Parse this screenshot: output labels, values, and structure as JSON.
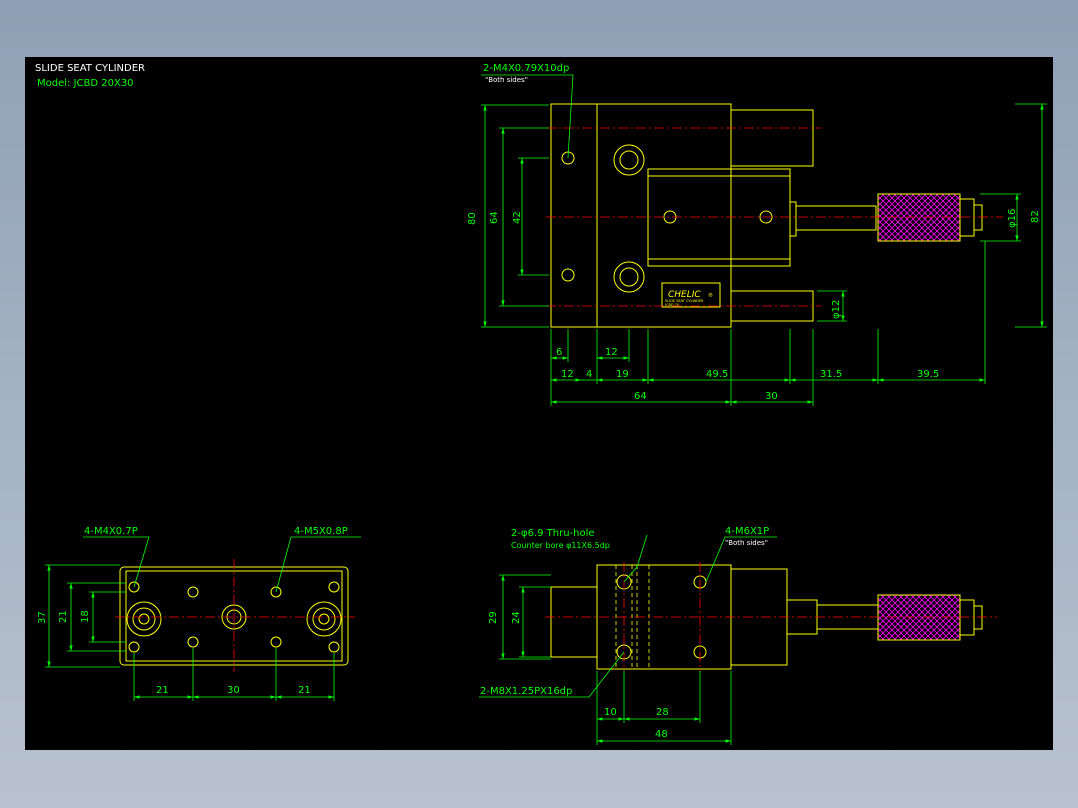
{
  "header": {
    "title": "SLIDE SEAT CYLINDER",
    "model": "Model:  JCBD 20X30"
  },
  "top_view": {
    "thread_note": "2-M4X0.79X10dp",
    "thread_note_sub": "\"Both sides\"",
    "brand": "CHELIC",
    "brand_suffix": "®",
    "label_line1": "SLIDE SEAT CYLINDER",
    "label_line2": "JCBD 20",
    "dims": {
      "h80": "80",
      "h64": "64",
      "h42": "42",
      "d16": "φ16",
      "h82": "82",
      "d12": "φ12",
      "w6": "6",
      "w12a": "12",
      "w12b": "12",
      "w4": "4",
      "w19": "19",
      "w49_5": "49.5",
      "w31_5": "31.5",
      "w39_5": "39.5",
      "w64": "64",
      "w30": "30"
    }
  },
  "end_view": {
    "note_left": "4-M4X0.7P",
    "note_right": "4-M5X0.8P",
    "dims": {
      "h37": "37",
      "h21": "21",
      "h18": "18",
      "w21a": "21",
      "w30": "30",
      "w21b": "21"
    }
  },
  "side_view": {
    "note_hole": "2-φ6.9  Thru-hole",
    "note_bore": "Counter bore  φ11X6.5dp",
    "note_m6": "4-M6X1P",
    "note_m6_sub": "\"Both sides\"",
    "note_m8": "2-M8X1.25PX16dp",
    "dims": {
      "h29": "29",
      "h24": "24",
      "w10": "10",
      "w28": "28",
      "w48": "48"
    }
  },
  "colors": {
    "outline": "#ffff00",
    "dimension": "#00ff00",
    "center": "#ff0000",
    "hatch": "#ff00ff",
    "background": "#000000"
  }
}
